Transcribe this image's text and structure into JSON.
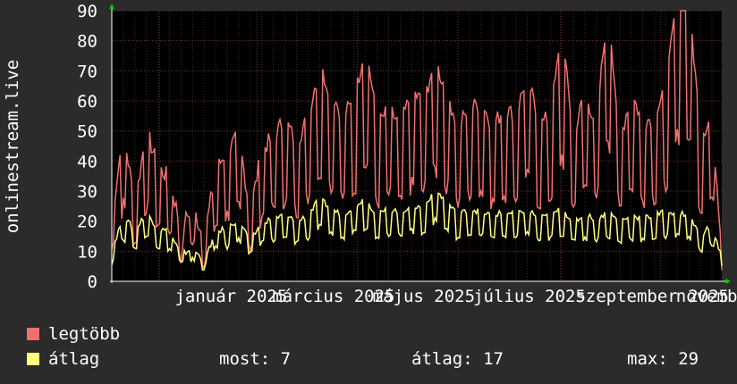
{
  "chart_data": {
    "type": "line",
    "ylabel": "onlinestream.live",
    "ylim": [
      0,
      90
    ],
    "yticks": [
      0,
      10,
      20,
      30,
      40,
      50,
      60,
      70,
      80,
      90
    ],
    "x_range": [
      "2024-12-03",
      "2025-12-08"
    ],
    "x_tick_labels": [
      {
        "label": "január 2025",
        "date": "2025-01-01"
      },
      {
        "label": "március 2025",
        "date": "2025-03-01"
      },
      {
        "label": "május 2025",
        "date": "2025-05-01"
      },
      {
        "label": "július 2025",
        "date": "2025-07-01"
      },
      {
        "label": "szeptember 2025",
        "date": "2025-09-01"
      },
      {
        "label": "november 2025",
        "date": "2025-11-01"
      }
    ],
    "grid": true,
    "background": "#000000",
    "gridColor": "#7a2f2f",
    "series": [
      {
        "name": "legtöbb",
        "color": "#f07070",
        "points": [
          [
            "2024-12-03",
            18
          ],
          [
            "2024-12-10",
            44
          ],
          [
            "2024-12-17",
            22
          ],
          [
            "2024-12-24",
            44
          ],
          [
            "2024-12-31",
            33
          ],
          [
            "2025-01-07",
            30
          ],
          [
            "2025-01-14",
            15
          ],
          [
            "2025-01-21",
            22
          ],
          [
            "2025-01-28",
            12
          ],
          [
            "2025-02-04",
            32
          ],
          [
            "2025-02-11",
            38
          ],
          [
            "2025-02-18",
            42
          ],
          [
            "2025-02-25",
            20
          ],
          [
            "2025-03-04",
            38
          ],
          [
            "2025-03-11",
            42
          ],
          [
            "2025-03-18",
            47
          ],
          [
            "2025-03-25",
            40
          ],
          [
            "2025-04-01",
            48
          ],
          [
            "2025-04-08",
            62
          ],
          [
            "2025-04-15",
            55
          ],
          [
            "2025-04-22",
            48
          ],
          [
            "2025-04-29",
            52
          ],
          [
            "2025-05-06",
            70
          ],
          [
            "2025-05-13",
            45
          ],
          [
            "2025-05-20",
            50
          ],
          [
            "2025-05-27",
            45
          ],
          [
            "2025-06-03",
            55
          ],
          [
            "2025-06-10",
            52
          ],
          [
            "2025-06-17",
            64
          ],
          [
            "2025-06-24",
            55
          ],
          [
            "2025-07-01",
            45
          ],
          [
            "2025-07-08",
            50
          ],
          [
            "2025-07-15",
            52
          ],
          [
            "2025-07-22",
            45
          ],
          [
            "2025-07-29",
            50
          ],
          [
            "2025-08-05",
            48
          ],
          [
            "2025-08-12",
            60
          ],
          [
            "2025-08-19",
            45
          ],
          [
            "2025-08-26",
            48
          ],
          [
            "2025-09-02",
            72
          ],
          [
            "2025-09-09",
            42
          ],
          [
            "2025-09-16",
            55
          ],
          [
            "2025-09-23",
            45
          ],
          [
            "2025-09-30",
            82
          ],
          [
            "2025-10-07",
            40
          ],
          [
            "2025-10-14",
            55
          ],
          [
            "2025-10-21",
            46
          ],
          [
            "2025-10-28",
            48
          ],
          [
            "2025-11-04",
            55
          ],
          [
            "2025-11-11",
            83
          ],
          [
            "2025-11-18",
            83
          ],
          [
            "2025-11-25",
            42
          ],
          [
            "2025-12-02",
            48
          ],
          [
            "2025-12-08",
            10
          ]
        ]
      },
      {
        "name": "átlag",
        "color": "#ffff80",
        "points": [
          [
            "2024-12-03",
            9
          ],
          [
            "2024-12-10",
            20
          ],
          [
            "2024-12-17",
            15
          ],
          [
            "2024-12-24",
            21
          ],
          [
            "2024-12-31",
            16
          ],
          [
            "2025-01-07",
            15
          ],
          [
            "2025-01-14",
            8
          ],
          [
            "2025-01-21",
            10
          ],
          [
            "2025-01-28",
            6
          ],
          [
            "2025-02-04",
            15
          ],
          [
            "2025-02-11",
            16
          ],
          [
            "2025-02-18",
            19
          ],
          [
            "2025-02-25",
            12
          ],
          [
            "2025-03-04",
            18
          ],
          [
            "2025-03-11",
            19
          ],
          [
            "2025-03-18",
            20
          ],
          [
            "2025-03-25",
            18
          ],
          [
            "2025-04-01",
            20
          ],
          [
            "2025-04-08",
            25
          ],
          [
            "2025-04-15",
            22
          ],
          [
            "2025-04-22",
            20
          ],
          [
            "2025-04-29",
            23
          ],
          [
            "2025-05-06",
            25
          ],
          [
            "2025-05-13",
            20
          ],
          [
            "2025-05-20",
            22
          ],
          [
            "2025-05-27",
            21
          ],
          [
            "2025-06-03",
            23
          ],
          [
            "2025-06-10",
            22
          ],
          [
            "2025-06-17",
            28
          ],
          [
            "2025-06-24",
            24
          ],
          [
            "2025-07-01",
            20
          ],
          [
            "2025-07-08",
            22
          ],
          [
            "2025-07-15",
            21
          ],
          [
            "2025-07-22",
            20
          ],
          [
            "2025-07-29",
            21
          ],
          [
            "2025-08-05",
            20
          ],
          [
            "2025-08-12",
            22
          ],
          [
            "2025-08-19",
            19
          ],
          [
            "2025-08-26",
            20
          ],
          [
            "2025-09-02",
            22
          ],
          [
            "2025-09-09",
            18
          ],
          [
            "2025-09-16",
            20
          ],
          [
            "2025-09-23",
            19
          ],
          [
            "2025-09-30",
            21
          ],
          [
            "2025-10-07",
            18
          ],
          [
            "2025-10-14",
            20
          ],
          [
            "2025-10-21",
            19
          ],
          [
            "2025-10-28",
            20
          ],
          [
            "2025-11-04",
            21
          ],
          [
            "2025-11-11",
            21
          ],
          [
            "2025-11-18",
            20
          ],
          [
            "2025-11-25",
            14
          ],
          [
            "2025-12-02",
            17
          ],
          [
            "2025-12-08",
            7
          ]
        ]
      }
    ]
  },
  "legend": [
    {
      "name": "legtöbb",
      "color": "#f07070"
    },
    {
      "name": "átlag",
      "color": "#ffff80"
    }
  ],
  "stats": {
    "now": "most: 7",
    "avg": "átlag: 17",
    "max": "max: 29"
  }
}
